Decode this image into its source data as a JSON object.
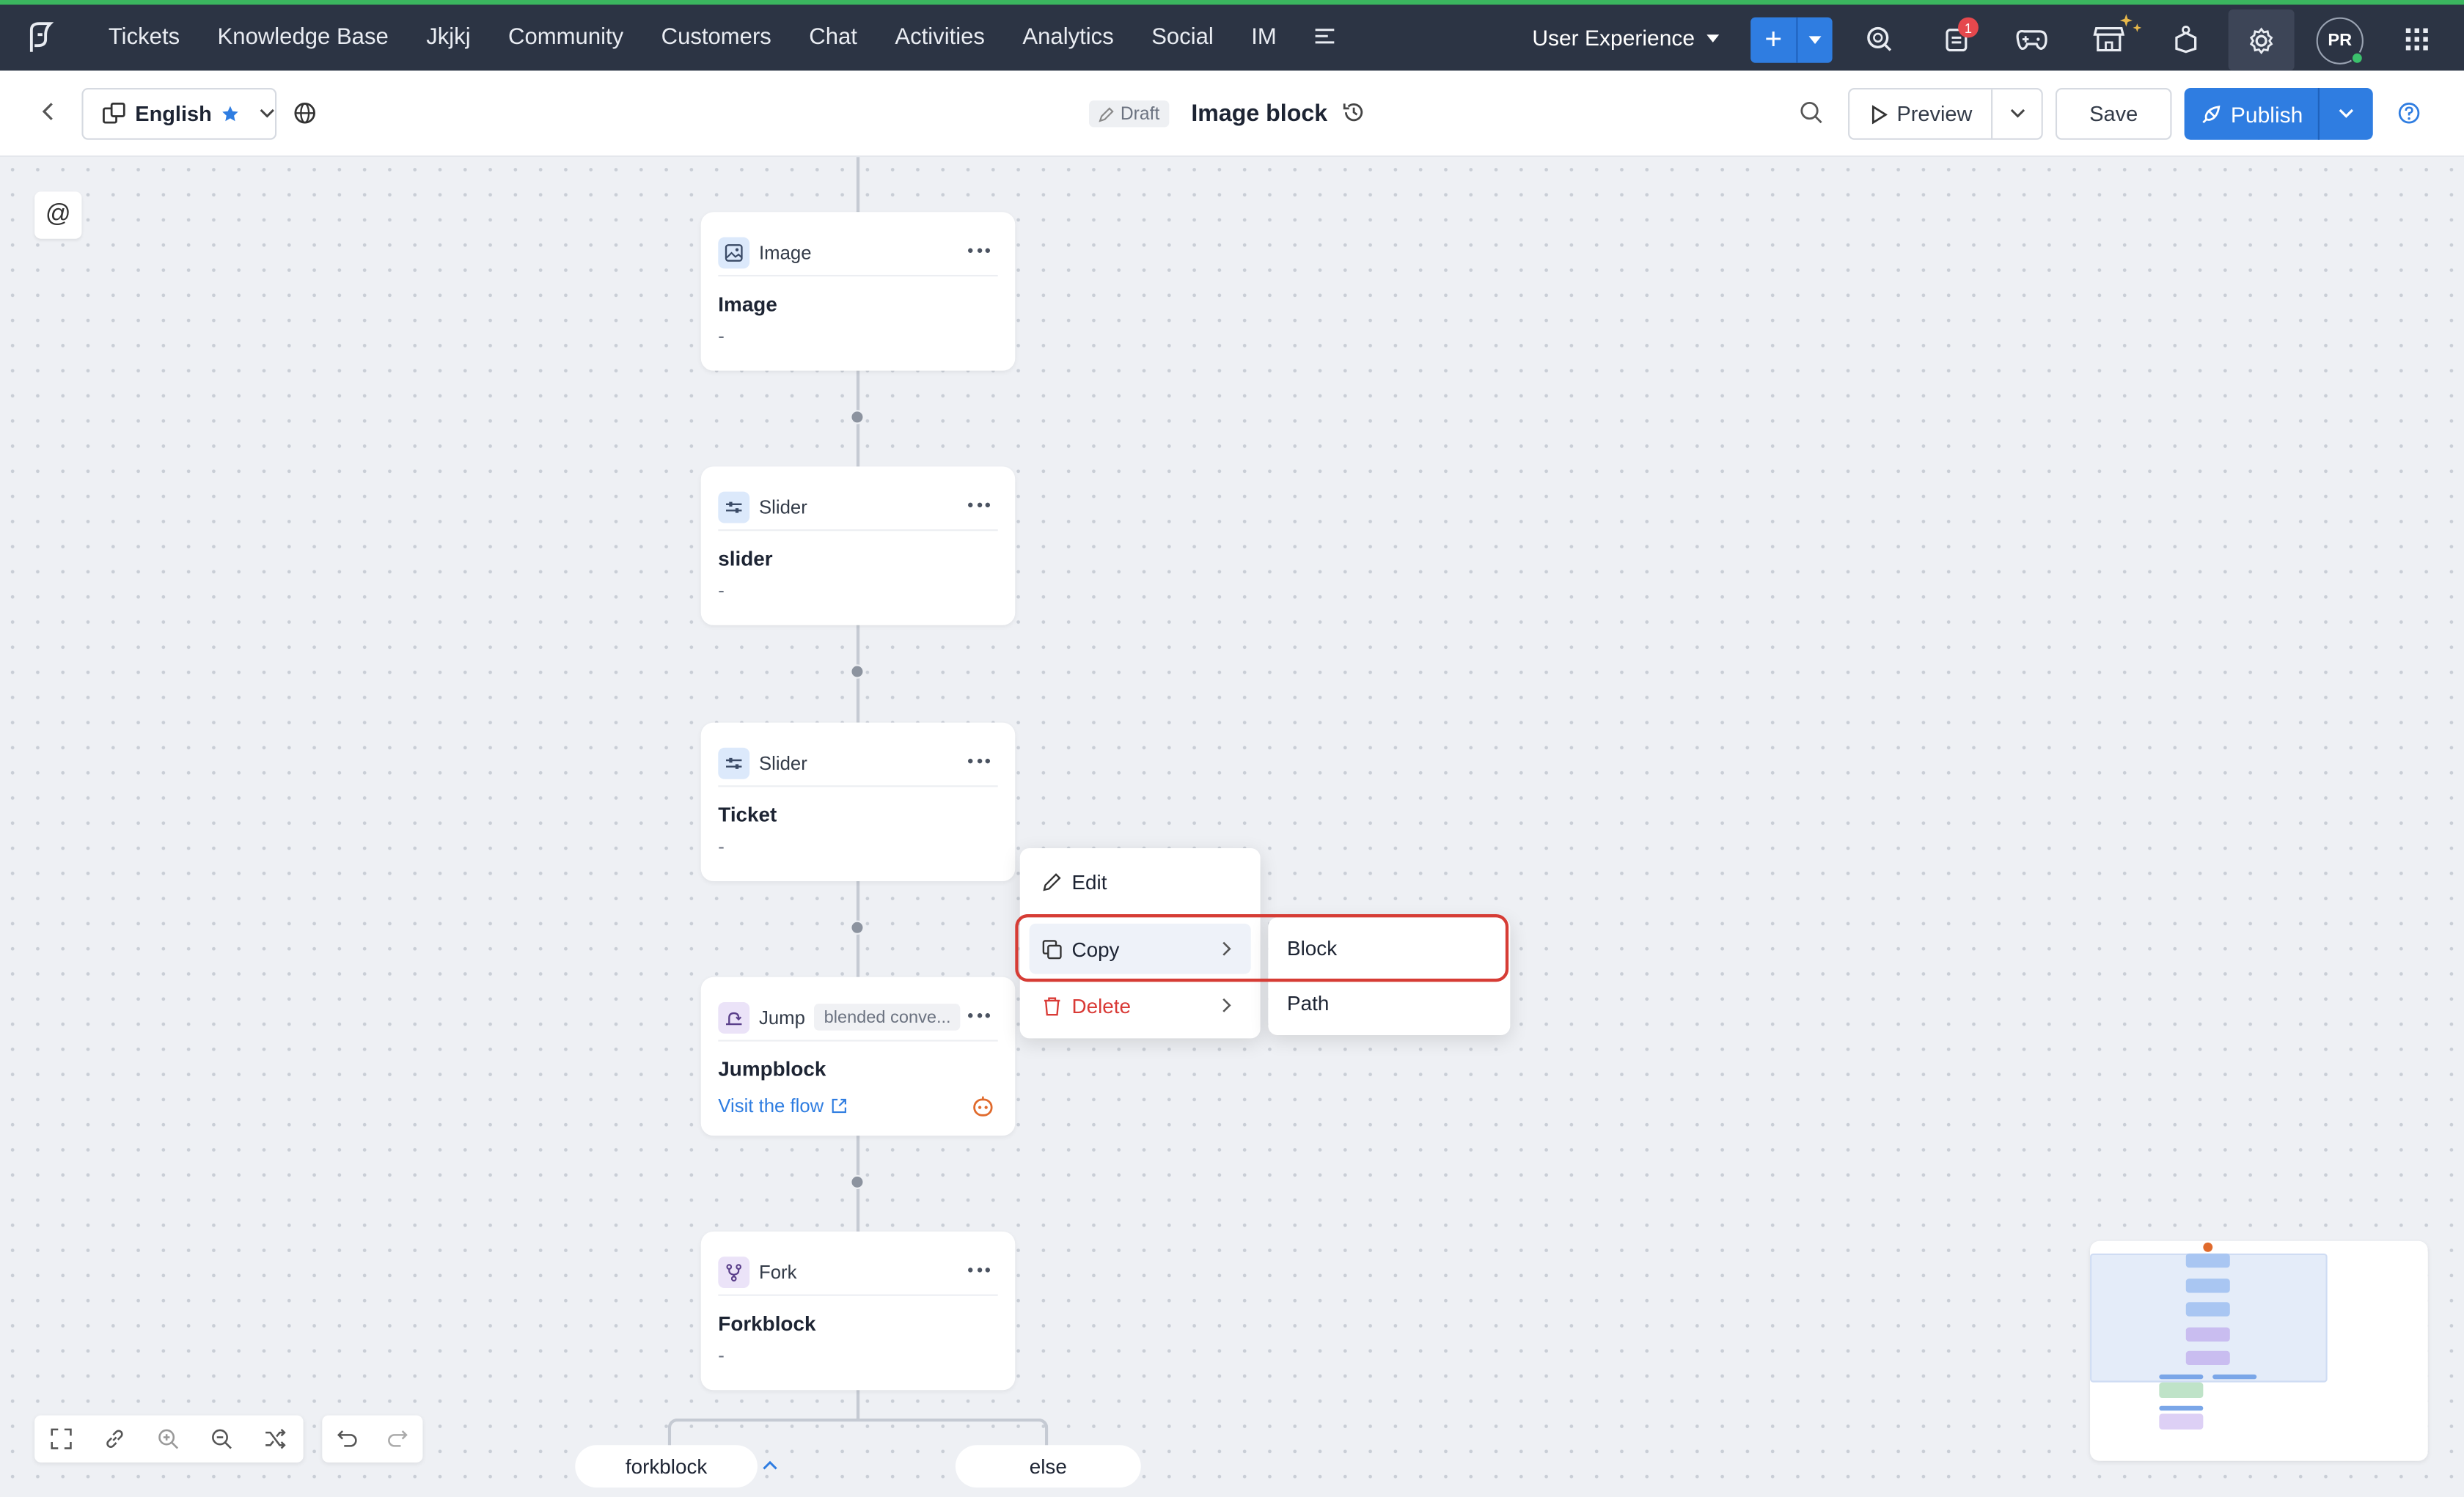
{
  "nav": {
    "items": [
      "Tickets",
      "Knowledge Base",
      "Jkjkj",
      "Community",
      "Customers",
      "Chat",
      "Activities",
      "Analytics",
      "Social",
      "IM"
    ],
    "department": "User Experience",
    "notification_count": "1",
    "avatar_initials": "PR"
  },
  "subheader": {
    "language": "English",
    "status": "Draft",
    "title": "Image block",
    "preview_label": "Preview",
    "save_label": "Save",
    "publish_label": "Publish"
  },
  "canvas": {
    "mention_symbol": "@",
    "blocks": [
      {
        "type": "Image",
        "name": "Image",
        "sub": "-"
      },
      {
        "type": "Slider",
        "name": "slider",
        "sub": "-"
      },
      {
        "type": "Slider",
        "name": "Ticket",
        "sub": "-"
      },
      {
        "type": "Jump",
        "tag": "blended conve...",
        "name": "Jumpblock",
        "link": "Visit the flow"
      },
      {
        "type": "Fork",
        "name": "Forkblock",
        "sub": "-"
      }
    ],
    "branches": [
      "forkblock",
      "else"
    ]
  },
  "context_menu": {
    "items": [
      "Edit",
      "Copy",
      "Delete"
    ],
    "copy_submenu": [
      "Block",
      "Path"
    ]
  },
  "colors": {
    "topbar": "#2c3444",
    "accent": "#2f7de1",
    "highlight": "#d63c35",
    "danger": "#d93a36"
  }
}
